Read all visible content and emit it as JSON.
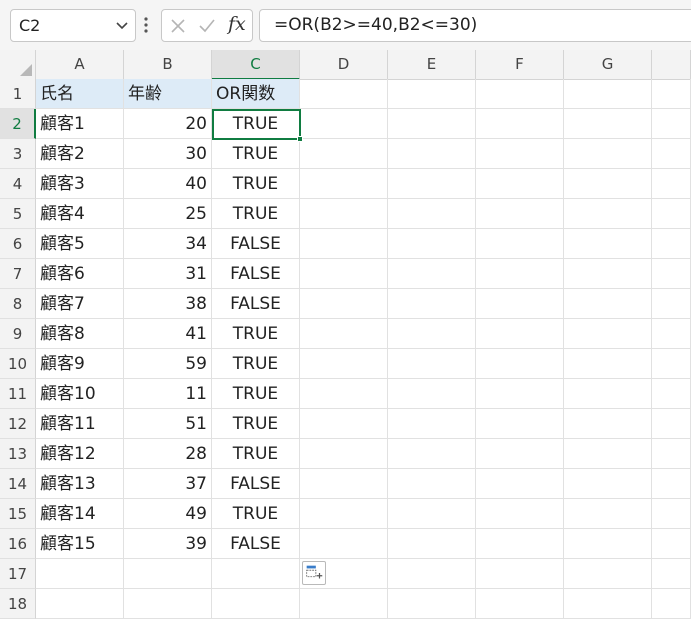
{
  "name_box": {
    "value": "C2"
  },
  "formula_bar": {
    "value": "=OR(B2>=40,B2<=30)",
    "fx_label": "fx"
  },
  "columns": [
    "A",
    "B",
    "C",
    "D",
    "E",
    "F",
    "G"
  ],
  "selected_column": "C",
  "selected_row": 2,
  "rows": [
    {
      "num": "1",
      "a": "氏名",
      "b": "年齢",
      "c": "OR関数"
    },
    {
      "num": "2",
      "a": "顧客1",
      "b": "20",
      "c": "TRUE"
    },
    {
      "num": "3",
      "a": "顧客2",
      "b": "30",
      "c": "TRUE"
    },
    {
      "num": "4",
      "a": "顧客3",
      "b": "40",
      "c": "TRUE"
    },
    {
      "num": "5",
      "a": "顧客4",
      "b": "25",
      "c": "TRUE"
    },
    {
      "num": "6",
      "a": "顧客5",
      "b": "34",
      "c": "FALSE"
    },
    {
      "num": "7",
      "a": "顧客6",
      "b": "31",
      "c": "FALSE"
    },
    {
      "num": "8",
      "a": "顧客7",
      "b": "38",
      "c": "FALSE"
    },
    {
      "num": "9",
      "a": "顧客8",
      "b": "41",
      "c": "TRUE"
    },
    {
      "num": "10",
      "a": "顧客9",
      "b": "59",
      "c": "TRUE"
    },
    {
      "num": "11",
      "a": "顧客10",
      "b": "11",
      "c": "TRUE"
    },
    {
      "num": "12",
      "a": "顧客11",
      "b": "51",
      "c": "TRUE"
    },
    {
      "num": "13",
      "a": "顧客12",
      "b": "28",
      "c": "TRUE"
    },
    {
      "num": "14",
      "a": "顧客13",
      "b": "37",
      "c": "FALSE"
    },
    {
      "num": "15",
      "a": "顧客14",
      "b": "49",
      "c": "TRUE"
    },
    {
      "num": "16",
      "a": "顧客15",
      "b": "39",
      "c": "FALSE"
    },
    {
      "num": "17",
      "a": "",
      "b": "",
      "c": ""
    },
    {
      "num": "18",
      "a": "",
      "b": "",
      "c": ""
    }
  ],
  "colors": {
    "accent": "#107c41",
    "header_fill": "#ddebf7"
  }
}
